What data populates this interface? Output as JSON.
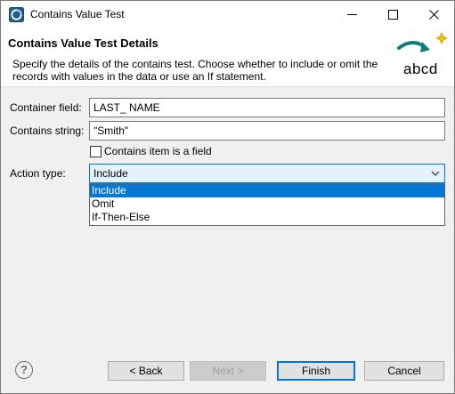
{
  "window": {
    "title": "Contains Value Test",
    "controls": [
      "minimize-icon",
      "maximize-icon",
      "close-icon"
    ]
  },
  "header": {
    "title": "Contains Value Test Details",
    "description": "Specify the details of the contains test. Choose whether to include or omit the records with values in the data or use an If statement.",
    "image_text": "abcd"
  },
  "form": {
    "container_field_label": "Container field:",
    "container_field_value": "LAST_ NAME",
    "contains_string_label": "Contains string:",
    "contains_string_value": "\"Smith\"",
    "contains_item_checkbox_label": "Contains item is a field",
    "contains_item_checked": false,
    "action_type_label": "Action type:",
    "action_type_value": "Include",
    "action_type_options": [
      "Include",
      "Omit",
      "If-Then-Else"
    ],
    "action_type_highlighted": "Include"
  },
  "footer": {
    "help_icon": "?",
    "back_label": "< Back",
    "next_label": "Next >",
    "finish_label": "Finish",
    "cancel_label": "Cancel"
  },
  "colors": {
    "accent": "#0078d7",
    "combo_background": "#e5f1fb",
    "dialog_background": "#f0f0f0"
  }
}
